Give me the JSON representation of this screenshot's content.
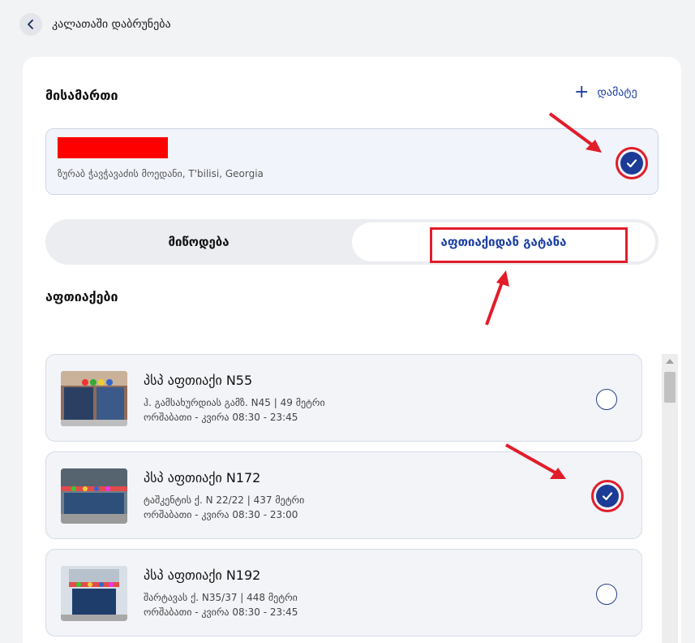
{
  "header": {
    "back_label": "კალათაში დაბრუნება"
  },
  "address": {
    "title": "მისამართი",
    "add_label": "დამატე",
    "address_line": "ზურაბ ჭავჭავაძის მოედანი, T'bilisi, Georgia",
    "selected": true
  },
  "delivery_toggle": {
    "options": [
      "მიწოდება",
      "აფთიაქიდან გატანა"
    ],
    "selected": "აფთიაქიდან გატანა"
  },
  "stores": {
    "title": "აფთიაქები",
    "items": [
      {
        "name": "პსპ აფთიაქი N55",
        "address": "ჰ. გამსახურდიას გამზ. N45 | 49 მეტრი",
        "hours": "ორშაბათი - კვირა 08:30 - 23:45",
        "selected": false
      },
      {
        "name": "პსპ აფთიაქი N172",
        "address": "ტაშკენტის ქ. N 22/22 | 437 მეტრი",
        "hours": "ორშაბათი - კვირა 08:30 - 23:00",
        "selected": true
      },
      {
        "name": "პსპ აფთიაქი N192",
        "address": "შარტავას ქ. N35/37 | 448 მეტრი",
        "hours": "ორშაბათი - კვირა 08:30 - 23:45",
        "selected": false
      }
    ]
  },
  "colors": {
    "accent": "#1b3fa3",
    "annotation_red": "#e11d2a"
  }
}
